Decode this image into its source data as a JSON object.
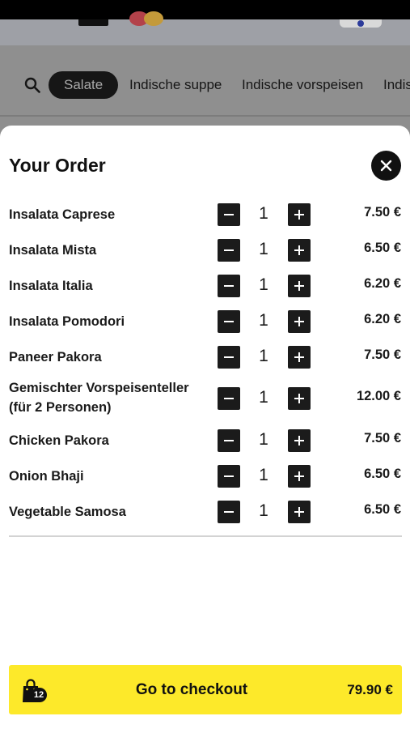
{
  "nav": {
    "categories": [
      {
        "label": "Salate",
        "active": true
      },
      {
        "label": "Indische suppe",
        "active": false
      },
      {
        "label": "Indische vorspeisen",
        "active": false
      },
      {
        "label": "Indis",
        "active": false
      }
    ],
    "search_icon": "search-icon"
  },
  "order": {
    "title": "Your Order",
    "close_icon": "close-icon",
    "items": [
      {
        "name": "Insalata Caprese",
        "qty": "1",
        "price": "7.50 €"
      },
      {
        "name": "Insalata Mista",
        "qty": "1",
        "price": "6.50 €"
      },
      {
        "name": "Insalata Italia",
        "qty": "1",
        "price": "6.20 €"
      },
      {
        "name": "Insalata Pomodori",
        "qty": "1",
        "price": "6.20 €"
      },
      {
        "name": "Paneer Pakora",
        "qty": "1",
        "price": "7.50 €"
      },
      {
        "name_line1": "Gemischter Vorspeisenteller",
        "name_line2": "(für 2 Personen)",
        "qty": "1",
        "price": "12.00 €"
      },
      {
        "name": "Chicken Pakora",
        "qty": "1",
        "price": "7.50 €"
      },
      {
        "name": "Onion Bhaji",
        "qty": "1",
        "price": "6.50 €"
      },
      {
        "name": "Vegetable Samosa",
        "qty": "1",
        "price": "6.50 €"
      }
    ]
  },
  "checkout": {
    "label": "Go to checkout",
    "total": "79.90 €",
    "item_count": "12",
    "bag_icon": "shopping-bag-icon",
    "accent_color": "#fde92a"
  }
}
